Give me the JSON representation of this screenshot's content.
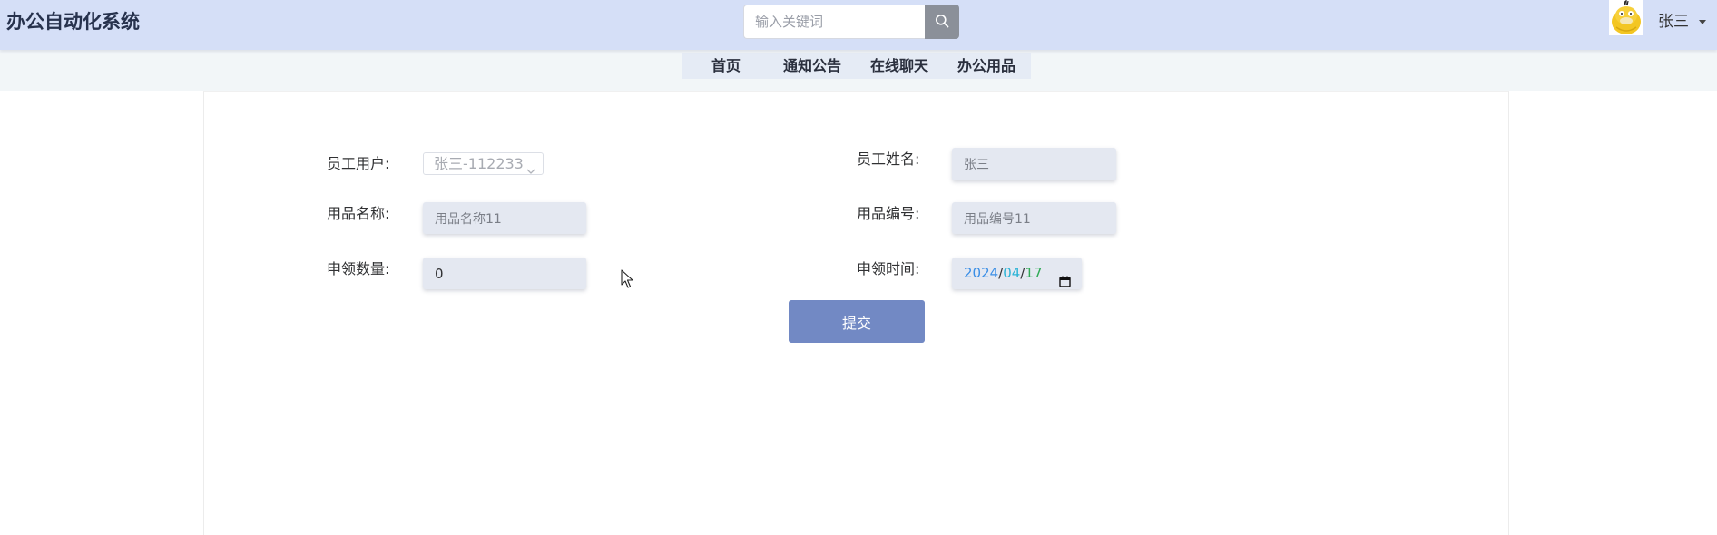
{
  "header": {
    "title": "办公自动化系统",
    "search": {
      "placeholder": "输入关键词",
      "value": ""
    },
    "user": {
      "name": "张三"
    }
  },
  "nav": {
    "items": [
      {
        "label": "首页"
      },
      {
        "label": "通知公告"
      },
      {
        "label": "在线聊天"
      },
      {
        "label": "办公用品"
      }
    ]
  },
  "form": {
    "employee_user": {
      "label": "员工用户:",
      "value": "张三-112233"
    },
    "employee_name": {
      "label": "员工姓名:",
      "value": "张三"
    },
    "item_name": {
      "label": "用品名称:",
      "value": "用品名称11"
    },
    "item_code": {
      "label": "用品编号:",
      "value": "用品编号11"
    },
    "quantity": {
      "label": "申领数量:",
      "value": "0"
    },
    "apply_date": {
      "label": "申领时间:",
      "year": "2024",
      "month": "04",
      "day": "17",
      "separator": "/"
    },
    "submit_label": "提交"
  },
  "colors": {
    "header_bg": "#d5dff7",
    "nav_bg": "#f2f6f8",
    "nav_menu_bg": "#e5ebf5",
    "input_bg": "#e4e8f1",
    "submit_bg": "#7289c4",
    "search_button_bg": "#8b9099"
  },
  "icons": {
    "search": "search-icon",
    "avatar": "duck-avatar",
    "caret": "caret-down-icon",
    "select": "chevron-down-icon",
    "calendar": "calendar-icon",
    "cursor": "mouse-cursor-icon"
  }
}
